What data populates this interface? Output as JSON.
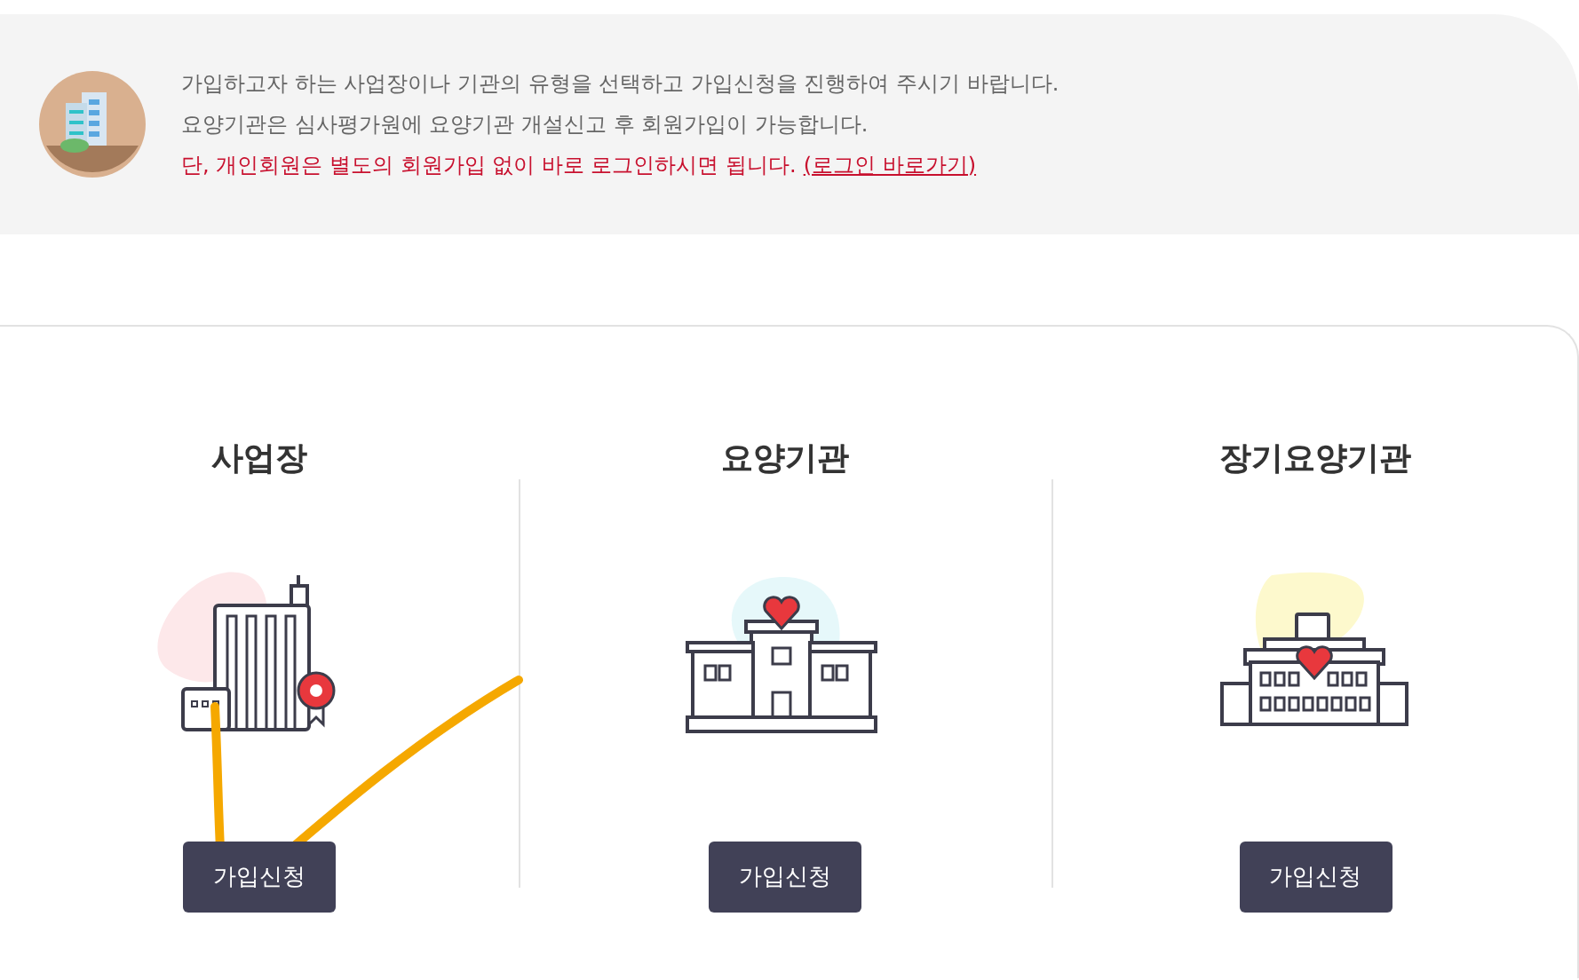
{
  "notice": {
    "lines": [
      "가입하고자 하는 사업장이나 기관의 유형을 선택하고 가입신청을 진행하여 주시기 바랍니다.",
      "요양기관은 심사평가원에 요양기관 개설신고 후 회원가입이 가능합니다."
    ],
    "warning": "단, 개인회원은 별도의 회원가입 없이 바로 로그인하시면 됩니다.",
    "link": "(로그인 바로가기)"
  },
  "types": [
    {
      "kind": "business",
      "title": "사업장",
      "button": "가입신청"
    },
    {
      "kind": "hospital",
      "title": "요양기관",
      "button": "가입신청"
    },
    {
      "kind": "longterm",
      "title": "장기요양기관",
      "button": "가입신청"
    }
  ]
}
